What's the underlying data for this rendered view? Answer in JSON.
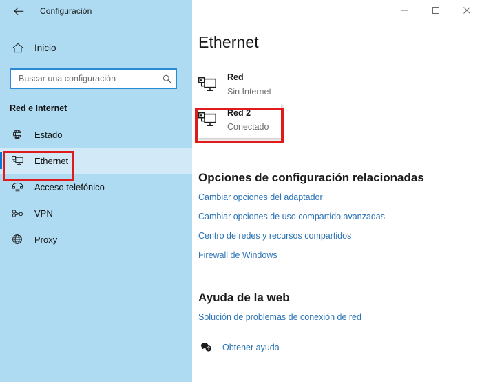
{
  "window": {
    "app_title": "Configuración",
    "back_icon": "back-arrow-icon",
    "controls": {
      "minimize": "—",
      "maximize": "▢",
      "close": "✕"
    }
  },
  "sidebar": {
    "home": {
      "label": "Inicio",
      "icon": "home-icon"
    },
    "search": {
      "placeholder": "Buscar una configuración",
      "value": "",
      "icon": "search-icon"
    },
    "section_heading": "Red e Internet",
    "items": [
      {
        "label": "Estado",
        "icon": "globe-status-icon",
        "selected": false
      },
      {
        "label": "Ethernet",
        "icon": "ethernet-icon",
        "selected": true
      },
      {
        "label": "Acceso telefónico",
        "icon": "dialup-phone-icon",
        "selected": false
      },
      {
        "label": "VPN",
        "icon": "vpn-key-icon",
        "selected": false
      },
      {
        "label": "Proxy",
        "icon": "globe-proxy-icon",
        "selected": false
      }
    ]
  },
  "main": {
    "page_title": "Ethernet",
    "networks": [
      {
        "name": "Red",
        "status": "Sin Internet",
        "icon": "network-pc-icon",
        "highlighted": false
      },
      {
        "name": "Red 2",
        "status": "Conectado",
        "icon": "network-pc-icon",
        "highlighted": true
      }
    ],
    "related_settings": {
      "heading": "Opciones de configuración relacionadas",
      "links": [
        "Cambiar opciones del adaptador",
        "Cambiar opciones de uso compartido avanzadas",
        "Centro de redes y recursos compartidos",
        "Firewall de Windows"
      ]
    },
    "web_help": {
      "heading": "Ayuda de la web",
      "links": [
        "Solución de problemas de conexión de red"
      ],
      "get_help": {
        "label": "Obtener ayuda",
        "icon": "chat-question-icon"
      }
    }
  },
  "colors": {
    "sidebar_bg": "#aedbf2",
    "accent": "#0078d7",
    "link": "#2a72b5",
    "annotation": "#e01b1b"
  }
}
